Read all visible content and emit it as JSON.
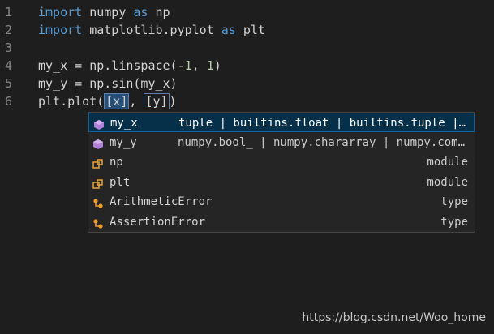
{
  "editor": {
    "lines": [
      {
        "num": "1",
        "parts": [
          {
            "t": "import",
            "c": "kw"
          },
          {
            "t": " numpy ",
            "c": "fn"
          },
          {
            "t": "as",
            "c": "kw"
          },
          {
            "t": " np",
            "c": "fn"
          }
        ]
      },
      {
        "num": "2",
        "parts": [
          {
            "t": "import",
            "c": "kw"
          },
          {
            "t": " matplotlib.pyplot ",
            "c": "fn"
          },
          {
            "t": "as",
            "c": "kw"
          },
          {
            "t": " plt",
            "c": "fn"
          }
        ]
      },
      {
        "num": "3",
        "parts": []
      },
      {
        "num": "4",
        "parts": [
          {
            "t": "my_x = np.linspace(",
            "c": "fn"
          },
          {
            "t": "-1",
            "c": "num"
          },
          {
            "t": ", ",
            "c": "fn"
          },
          {
            "t": "1",
            "c": "num"
          },
          {
            "t": ")",
            "c": "fn"
          }
        ]
      },
      {
        "num": "5",
        "parts": [
          {
            "t": "my_y = np.sin(my_x)",
            "c": "fn"
          }
        ]
      },
      {
        "num": "6",
        "parts": [
          {
            "t": "plt.plot(",
            "c": "fn"
          },
          {
            "t": "[x]",
            "c": "hl"
          },
          {
            "t": ", ",
            "c": "fn"
          },
          {
            "t": "[y]",
            "c": "hl2"
          },
          {
            "t": ")",
            "c": "fn"
          }
        ]
      }
    ]
  },
  "suggest": {
    "items": [
      {
        "label": "my_x",
        "detail": "tuple | builtins.float | builtins.tuple |…",
        "kind": "",
        "icon": "variable-icon",
        "selected": true
      },
      {
        "label": "my_y",
        "detail": "numpy.bool_ | numpy.chararray | numpy.com…",
        "kind": "",
        "icon": "variable-icon",
        "selected": false
      },
      {
        "label": "np",
        "detail": "",
        "kind": "module",
        "icon": "module-icon",
        "selected": false
      },
      {
        "label": "plt",
        "detail": "",
        "kind": "module",
        "icon": "module-icon",
        "selected": false
      },
      {
        "label": "ArithmeticError",
        "detail": "",
        "kind": "type",
        "icon": "class-icon",
        "selected": false
      },
      {
        "label": "AssertionError",
        "detail": "",
        "kind": "type",
        "icon": "class-icon",
        "selected": false
      }
    ]
  },
  "watermark": "https://blog.csdn.net/Woo_home",
  "colors": {
    "background": "#1e1e1e",
    "keyword": "#569cd6",
    "number": "#b5cea8",
    "variable_icon": "#b180d7",
    "module_icon": "#e8a33d",
    "class_icon": "#ee9d28"
  }
}
